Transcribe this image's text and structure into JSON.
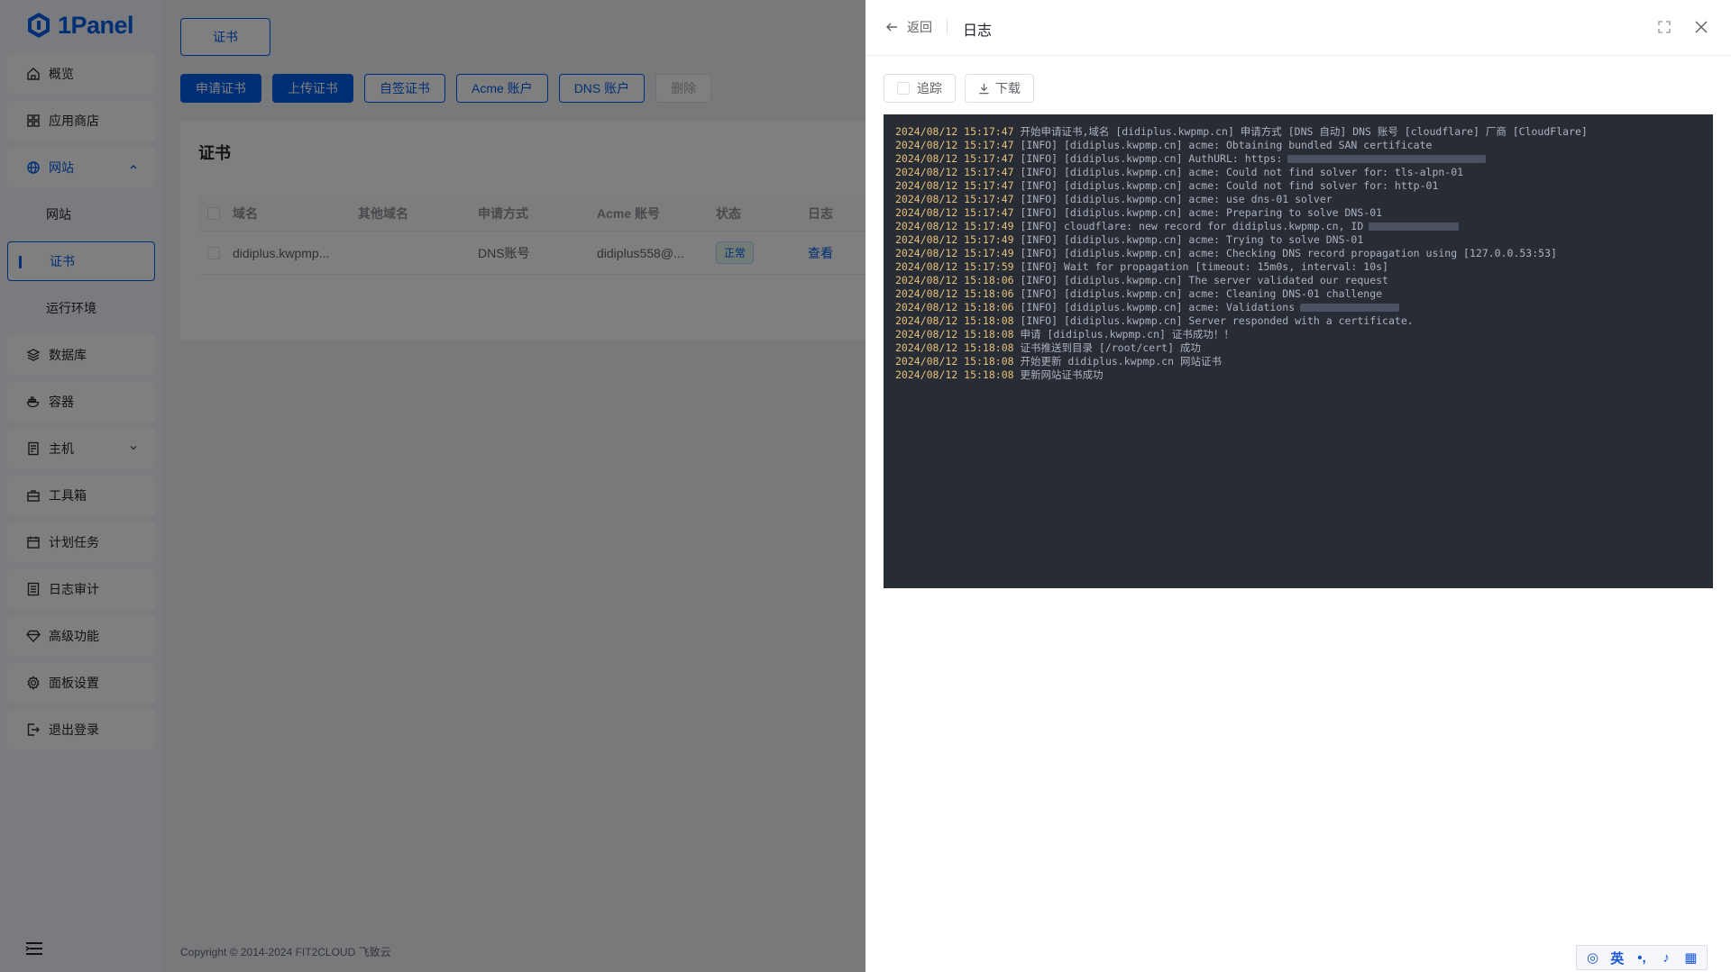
{
  "app": {
    "logo_text": "1Panel"
  },
  "sidebar": {
    "items": [
      {
        "label": "概览",
        "icon": "home-icon"
      },
      {
        "label": "应用商店",
        "icon": "apps-icon"
      },
      {
        "label": "网站",
        "icon": "globe-icon",
        "expanded": true
      },
      {
        "label": "数据库",
        "icon": "layers-icon"
      },
      {
        "label": "容器",
        "icon": "docker-icon"
      },
      {
        "label": "主机",
        "icon": "server-icon"
      },
      {
        "label": "工具箱",
        "icon": "toolbox-icon"
      },
      {
        "label": "计划任务",
        "icon": "calendar-icon"
      },
      {
        "label": "日志审计",
        "icon": "log-icon"
      },
      {
        "label": "高级功能",
        "icon": "diamond-icon"
      },
      {
        "label": "面板设置",
        "icon": "gear-icon"
      },
      {
        "label": "退出登录",
        "icon": "logout-icon"
      }
    ],
    "website_sub": [
      "网站",
      "证书",
      "运行环境"
    ],
    "active_sub": "证书"
  },
  "main": {
    "tab_label": "证书",
    "toolbar": {
      "apply": "申请证书",
      "upload": "上传证书",
      "selfsign": "自签证书",
      "acme": "Acme 账户",
      "dns": "DNS 账户",
      "delete": "删除"
    },
    "card_title": "证书",
    "table": {
      "headers": [
        "域名",
        "其他域名",
        "申请方式",
        "Acme 账号",
        "状态",
        "日志"
      ],
      "row": {
        "domain": "didiplus.kwpmp...",
        "other": "",
        "method": "DNS账号",
        "acme": "didiplus558@...",
        "status": "正常",
        "log": "查看"
      }
    },
    "footer": "Copyright © 2014-2024 FIT2CLOUD 飞致云"
  },
  "drawer": {
    "back_label": "返回",
    "title": "日志",
    "follow_label": "追踪",
    "download_label": "下载",
    "log_lines": [
      [
        "2024/08/12 15:17:47",
        " 开始申请证书,域名 [didiplus.kwpmp.cn] 申请方式 [DNS 自动] DNS 账号 [cloudflare] 厂商 [CloudFlare]"
      ],
      [
        "2024/08/12 15:17:47",
        " [INFO] [didiplus.kwpmp.cn] acme: Obtaining bundled SAN certificate"
      ],
      [
        "2024/08/12 15:17:47",
        " [INFO] [didiplus.kwpmp.cn] AuthURL: https:"
      ],
      [
        "2024/08/12 15:17:47",
        " [INFO] [didiplus.kwpmp.cn] acme: Could not find solver for: tls-alpn-01"
      ],
      [
        "2024/08/12 15:17:47",
        " [INFO] [didiplus.kwpmp.cn] acme: Could not find solver for: http-01"
      ],
      [
        "2024/08/12 15:17:47",
        " [INFO] [didiplus.kwpmp.cn] acme: use dns-01 solver"
      ],
      [
        "2024/08/12 15:17:47",
        " [INFO] [didiplus.kwpmp.cn] acme: Preparing to solve DNS-01"
      ],
      [
        "2024/08/12 15:17:49",
        " [INFO] cloudflare: new record for didiplus.kwpmp.cn, ID"
      ],
      [
        "2024/08/12 15:17:49",
        " [INFO] [didiplus.kwpmp.cn] acme: Trying to solve DNS-01"
      ],
      [
        "2024/08/12 15:17:49",
        " [INFO] [didiplus.kwpmp.cn] acme: Checking DNS record propagation using [127.0.0.53:53]"
      ],
      [
        "2024/08/12 15:17:59",
        " [INFO] Wait for propagation [timeout: 15m0s, interval: 10s]"
      ],
      [
        "2024/08/12 15:18:06",
        " [INFO] [didiplus.kwpmp.cn] The server validated our request"
      ],
      [
        "2024/08/12 15:18:06",
        " [INFO] [didiplus.kwpmp.cn] acme: Cleaning DNS-01 challenge"
      ],
      [
        "2024/08/12 15:18:06",
        " [INFO] [didiplus.kwpmp.cn] acme: Validations"
      ],
      [
        "2024/08/12 15:18:08",
        " [INFO] [didiplus.kwpmp.cn] Server responded with a certificate."
      ],
      [
        "2024/08/12 15:18:08",
        " 申请 [didiplus.kwpmp.cn] 证书成功！！"
      ],
      [
        "2024/08/12 15:18:08",
        " 证书推送到目录 [/root/cert] 成功"
      ],
      [
        "2024/08/12 15:18:08",
        " 开始更新 didiplus.kwpmp.cn 网站证书"
      ],
      [
        "2024/08/12 15:18:08",
        " 更新网站证书成功"
      ]
    ]
  },
  "ime": {
    "lang": "英"
  },
  "colors": {
    "primary": "#005eeb",
    "log_bg": "#282c34",
    "timestamp": "#e5c07b"
  }
}
